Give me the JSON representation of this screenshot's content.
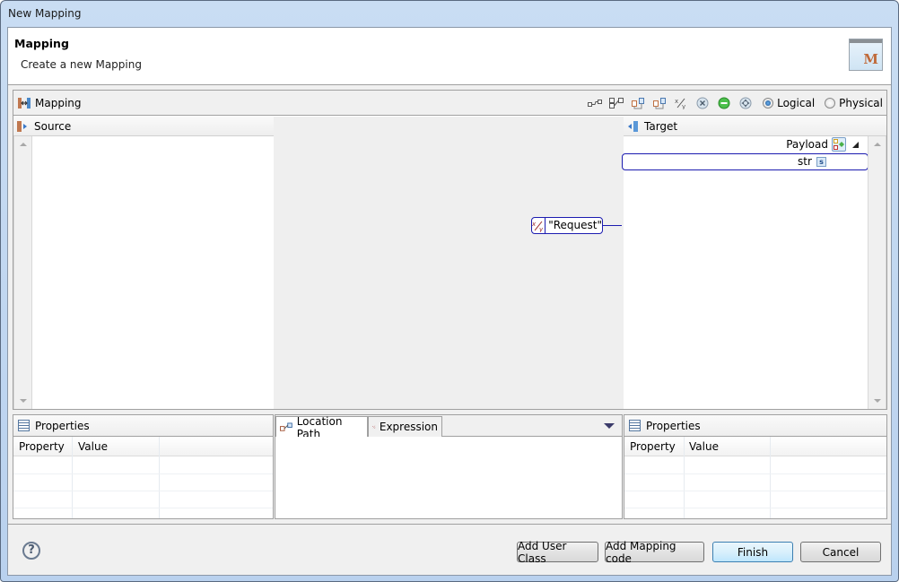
{
  "window": {
    "title": "New Mapping"
  },
  "banner": {
    "heading": "Mapping",
    "subheading": "Create a new Mapping",
    "icon": "mapping-wizard-icon"
  },
  "editor": {
    "title": "Mapping",
    "toolbar": {
      "buttons": [
        {
          "name": "connect-icon",
          "glyph": "▫⌐▫"
        },
        {
          "name": "tree-link-icon",
          "glyph": "⊞⊞"
        },
        {
          "name": "expand-icon",
          "glyph": "⧉"
        },
        {
          "name": "collapse-icon",
          "glyph": "⧉"
        },
        {
          "name": "expression-icon",
          "glyph": "x/y"
        },
        {
          "name": "delete-icon",
          "glyph": "⊗"
        },
        {
          "name": "status-green-icon",
          "glyph": "●"
        },
        {
          "name": "settings-icon",
          "glyph": "⊛"
        }
      ],
      "view_mode": {
        "options": [
          "Logical",
          "Physical"
        ],
        "selected": "Logical"
      }
    },
    "source": {
      "title": "Source"
    },
    "target": {
      "title": "Target",
      "root_node": "Payload",
      "child_node": "str",
      "child_type_badge": "s"
    },
    "mapping_constant": {
      "value": "\"Request\"",
      "icon": "x/y"
    }
  },
  "properties_left": {
    "title": "Properties",
    "columns": [
      "Property",
      "Value"
    ],
    "rows": []
  },
  "middle_tabs": {
    "tabs": [
      {
        "label": "Location Path",
        "active": true
      },
      {
        "label": "Expression",
        "active": false
      }
    ]
  },
  "properties_right": {
    "title": "Properties",
    "columns": [
      "Property",
      "Value"
    ],
    "rows": []
  },
  "footer": {
    "help": "?",
    "buttons": {
      "add_user_class": "Add User Class",
      "add_mapping_code": "Add Mapping code",
      "finish": "Finish",
      "cancel": "Cancel"
    }
  }
}
